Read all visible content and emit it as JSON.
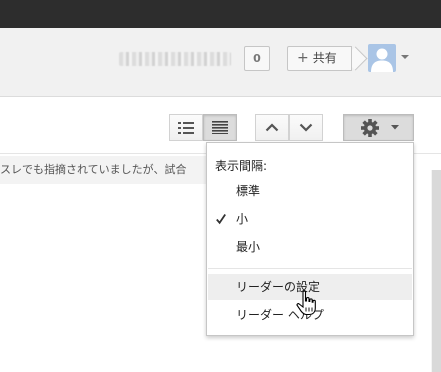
{
  "header": {
    "username_redacted": "",
    "notifications_count": "0",
    "share_label": "共有",
    "share_plus": "+"
  },
  "content": {
    "snippet_text": "スレでも指摘されていましたが、試合"
  },
  "toolbar": {
    "list_view_icon": "list-view-icon",
    "compact_view_icon": "compact-list-icon",
    "prev_icon": "chevron-up-icon",
    "next_icon": "chevron-down-icon",
    "settings_icon": "gear-icon"
  },
  "settings_menu": {
    "heading": "表示間隔:",
    "items": [
      {
        "label": "標準",
        "checked": false
      },
      {
        "label": "小",
        "checked": true
      },
      {
        "label": "最小",
        "checked": false
      }
    ],
    "actions": [
      {
        "label": "リーダーの設定",
        "hovered": true
      },
      {
        "label": "リーダー ヘルプ",
        "hovered": false
      }
    ]
  },
  "colors": {
    "topbar": "#2d2d2d",
    "header_bg": "#f1f1f1",
    "avatar_bg": "#aac5e6",
    "menu_hover": "#eeeeee"
  }
}
